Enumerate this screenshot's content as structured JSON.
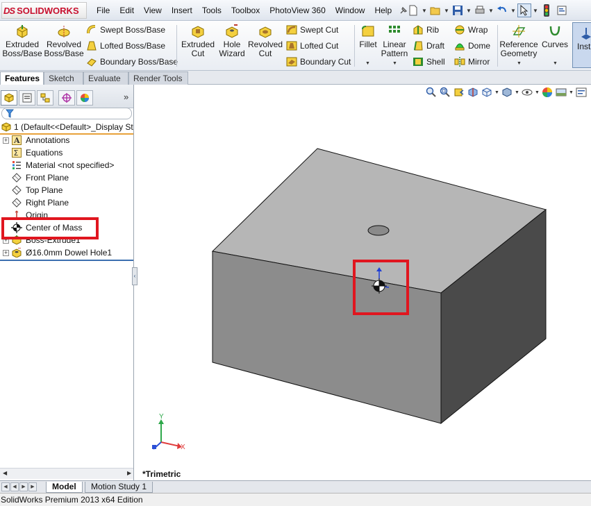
{
  "app": {
    "logo_prefix": "DS",
    "logo_name": "SOLIDWORKS"
  },
  "menu": [
    "File",
    "Edit",
    "View",
    "Insert",
    "Tools",
    "Toolbox",
    "PhotoView 360",
    "Window",
    "Help"
  ],
  "ribbon": {
    "extruded_boss": "Extruded Boss/Base",
    "revolved_boss": "Revolved Boss/Base",
    "swept_boss": "Swept Boss/Base",
    "lofted_boss": "Lofted Boss/Base",
    "boundary_boss": "Boundary Boss/Base",
    "extruded_cut": "Extruded Cut",
    "hole_wizard": "Hole Wizard",
    "revolved_cut": "Revolved Cut",
    "swept_cut": "Swept Cut",
    "lofted_cut": "Lofted Cut",
    "boundary_cut": "Boundary Cut",
    "fillet": "Fillet",
    "linear_pattern": "Linear Pattern",
    "rib": "Rib",
    "draft": "Draft",
    "shell": "Shell",
    "wrap": "Wrap",
    "dome": "Dome",
    "mirror": "Mirror",
    "reference_geometry": "Reference Geometry",
    "curves": "Curves",
    "instant3d": "Insta"
  },
  "tabs": [
    "Features",
    "Sketch",
    "Evaluate",
    "Render Tools"
  ],
  "tree": {
    "root": "1  (Default<<Default>_Display St",
    "items": [
      {
        "label": "Annotations",
        "icon": "annotations-icon"
      },
      {
        "label": "Equations",
        "icon": "equations-icon"
      },
      {
        "label": "Material <not specified>",
        "icon": "material-icon"
      },
      {
        "label": "Front Plane",
        "icon": "plane-icon"
      },
      {
        "label": "Top Plane",
        "icon": "plane-icon"
      },
      {
        "label": "Right Plane",
        "icon": "plane-icon"
      },
      {
        "label": "Origin",
        "icon": "origin-icon"
      },
      {
        "label": "Center of Mass",
        "icon": "center-of-mass-icon"
      },
      {
        "label": "Boss-Extrude1",
        "icon": "extrude-feature-icon"
      },
      {
        "label": "Ø16.0mm Dowel Hole1",
        "icon": "hole-feature-icon"
      }
    ]
  },
  "graphics": {
    "view_name": "*Trimetric",
    "triad_labels": {
      "x": "X",
      "y": "Y"
    }
  },
  "bottom_tabs": [
    "Model",
    "Motion Study 1"
  ],
  "status": "SolidWorks Premium 2013 x64 Edition",
  "colors": {
    "highlight_box": "#e0161f",
    "brand_red": "#c8102e",
    "part_top": "#b6b6b6",
    "part_front": "#8c8c8c",
    "part_side": "#4a4a4a"
  }
}
